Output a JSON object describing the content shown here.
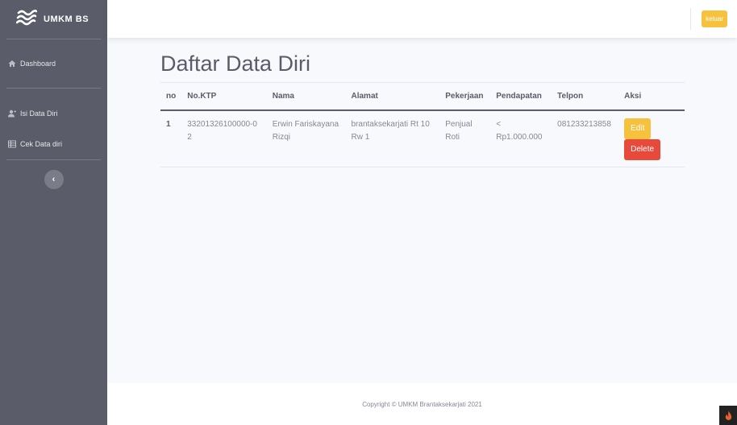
{
  "brand": {
    "name": "UMKM BS"
  },
  "sidebar": {
    "items": [
      {
        "label": "Dashboard",
        "icon": "home-icon"
      },
      {
        "label": "Isi Data Diri",
        "icon": "user-add-icon"
      },
      {
        "label": "Cek Data diri",
        "icon": "table-icon"
      }
    ],
    "toggle_glyph": "‹"
  },
  "topbar": {
    "logout_label": "keluar"
  },
  "main": {
    "title": "Daftar Data Diri",
    "table": {
      "headers": [
        "no",
        "No.KTP",
        "Nama",
        "Alamat",
        "Pekerjaan",
        "Pendapatan",
        "Telpon",
        "Aksi"
      ],
      "rows": [
        {
          "no": "1",
          "ktp": "33201326100000-02",
          "nama": "Erwin Fariskayana Rizqi",
          "alamat": "brantaksekarjati Rt 10 Rw 1",
          "pekerjaan": "Penjual Roti",
          "pendapatan": "< Rp1.000.000",
          "telpon": "081233213858",
          "edit_label": "Edit",
          "delete_label": "Delete"
        }
      ]
    }
  },
  "footer": {
    "text": "Copyright © UMKM Brantaksekarjati 2021"
  },
  "colors": {
    "sidebar": "#5a5c69",
    "warning": "#f6c23e",
    "danger": "#e74a3b"
  }
}
